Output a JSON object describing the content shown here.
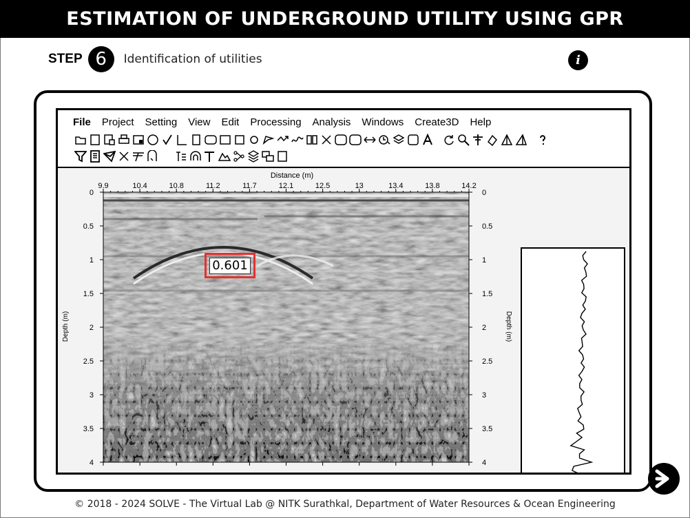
{
  "header": {
    "title": "ESTIMATION OF UNDERGROUND UTILITY USING GPR"
  },
  "step": {
    "label": "STEP",
    "number": "6",
    "description": "Identification of utilities"
  },
  "info": {
    "glyph": "i",
    "icon": "info-icon"
  },
  "menu": {
    "file": "File",
    "project": "Project",
    "setting": "Setting",
    "view": "View",
    "edit": "Edit",
    "processing": "Processing",
    "analysis": "Analysis",
    "windows": "Windows",
    "create3d": "Create3D",
    "help": "Help"
  },
  "radargram": {
    "x_axis_title": "Distance (m)",
    "y_axis_title": "Depth (m)",
    "y_axis_title_right": "Depth (m)",
    "x_ticks": [
      "9.9",
      "10.4",
      "10.8",
      "11.2",
      "11.7",
      "12.1",
      "12.5",
      "13",
      "13.4",
      "13.8",
      "14.2"
    ],
    "y_ticks": [
      "0",
      "0.5",
      "1",
      "1.5",
      "2",
      "2.5",
      "3",
      "3.5",
      "4"
    ],
    "x_range": [
      9.9,
      14.2
    ],
    "y_range": [
      0,
      4
    ],
    "hyperbola_apex": {
      "distance_m": 11.6,
      "depth_m": 0.72
    },
    "measured_depth_label": "0.601",
    "highlight_color": "#e53030"
  },
  "navigation": {
    "next_icon": "arrow-right-icon"
  },
  "footer": {
    "text": "© 2018 - 2024 SOLVE - The Virtual Lab @ NITK Surathkal, Department of Water Resources & Ocean Engineering"
  }
}
